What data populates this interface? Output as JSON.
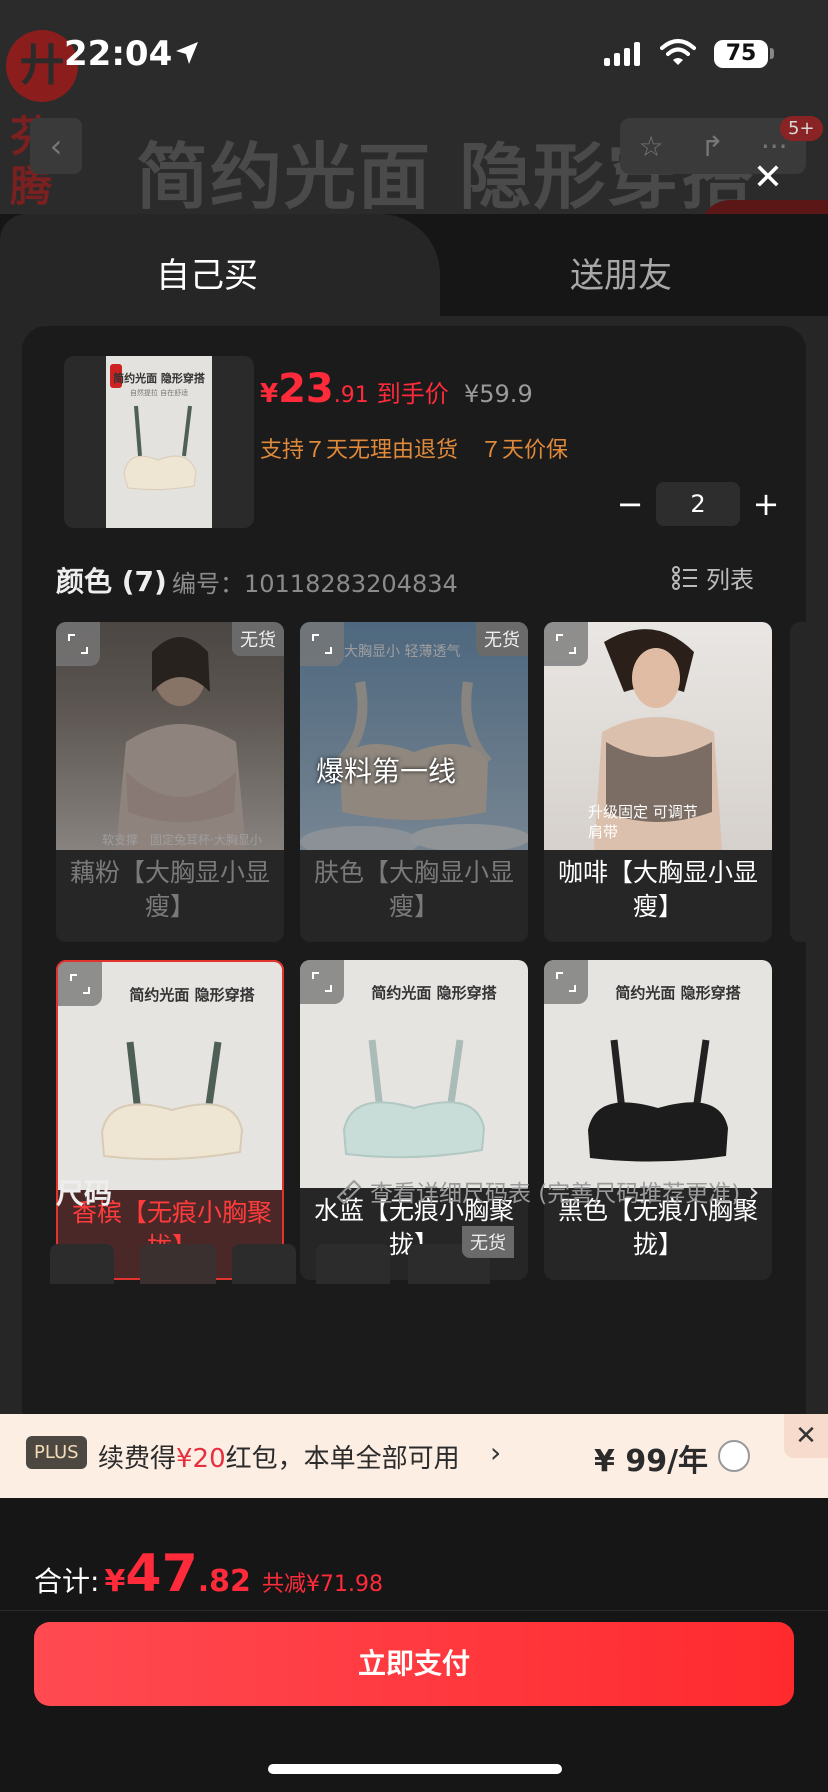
{
  "status_bar": {
    "time": "22:04",
    "battery": "75"
  },
  "background_page": {
    "brand": "芬腾",
    "headline": "简约光面 隐形穿搭",
    "badge": "5+"
  },
  "tabs": {
    "self": "自己买",
    "friend": "送朋友"
  },
  "product": {
    "price_currency": "¥",
    "price_int": "23",
    "price_dec": ".91",
    "price_tag": "到手价",
    "original_price": "¥59.9",
    "guarantee": "支持７天无理由退货　７天价保",
    "thumb_title": "简约光面 隐形穿搭",
    "thumb_sub": "自然提拉 自在舒适"
  },
  "quantity": {
    "minus": "−",
    "value": "2",
    "plus": "+"
  },
  "color_section": {
    "title": "颜色 (7)",
    "code": "编号：10118283204834",
    "list_label": "列表"
  },
  "variants": [
    {
      "label": "藕粉【大胸显小显瘦】",
      "out_of_stock": true,
      "badge": "无货",
      "caption": "软支撑　固定兔耳杯·大胸显小"
    },
    {
      "label": "肤色【大胸显小显瘦】",
      "out_of_stock": true,
      "badge": "无货",
      "caption": "大胸显小 轻薄透气"
    },
    {
      "label": "咖啡【大胸显小显瘦】",
      "out_of_stock": false,
      "caption": "升级固定 可调节肩带"
    },
    {
      "label": "香槟【无痕小胸聚拢】",
      "selected": true,
      "caption": "简约光面 隐形穿搭"
    },
    {
      "label": "水蓝【无痕小胸聚拢】",
      "caption": "简约光面 隐形穿搭"
    },
    {
      "label": "黑色【无痕小胸聚拢】",
      "caption": "简约光面 隐形穿搭"
    }
  ],
  "overlay_text": "爆料第一线",
  "size_section": {
    "title": "尺码",
    "link": "查看详细尺码表 (完善尺码推荐更准)",
    "oos_badge": "无货"
  },
  "plus_bar": {
    "badge": "PLUS",
    "text_before": "续费得",
    "text_red": "¥20",
    "text_after": "红包，本单全部可用",
    "price": "¥ 99/年",
    "close": "✕"
  },
  "footer": {
    "total_label": "合计:",
    "total_currency": "¥",
    "total_int": "47",
    "total_dec": ".82",
    "total_save": "共减¥71.98",
    "pay_label": "立即支付"
  },
  "colors": {
    "accent": "#ff2b3a",
    "orange": "#e0893a",
    "plus_bg": "#fdeee4"
  }
}
